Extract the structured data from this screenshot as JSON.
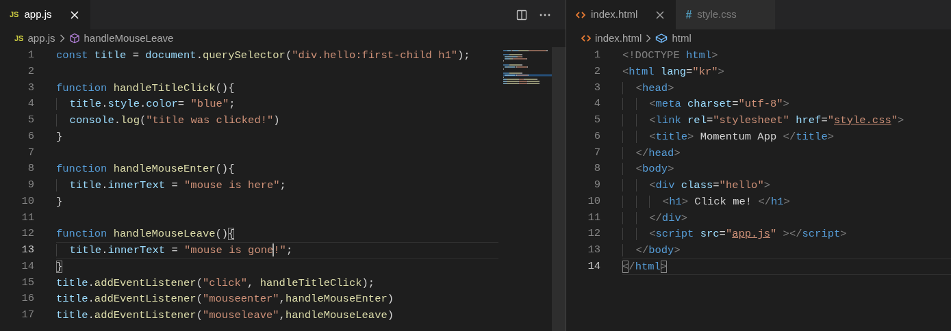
{
  "panes": [
    {
      "tabs": [
        {
          "kind": "js",
          "icon_text": "JS",
          "label": "app.js",
          "selected": true,
          "close_visible": true
        }
      ],
      "actions": [
        {
          "kind": "split"
        },
        {
          "kind": "more"
        }
      ],
      "breadcrumb": [
        {
          "kind": "js",
          "icon_text": "JS",
          "label": "app.js"
        },
        {
          "kind": "method",
          "label": "handleMouseLeave"
        }
      ],
      "minimap": true,
      "lines": [
        {
          "number": "1",
          "current": false,
          "tokens": [
            {
              "kind": "keyword",
              "text": "const "
            },
            {
              "kind": "variable",
              "text": "title"
            },
            {
              "kind": "plain",
              "text": " = "
            },
            {
              "kind": "variable",
              "text": "document"
            },
            {
              "kind": "plain",
              "text": "."
            },
            {
              "kind": "function",
              "text": "querySelector"
            },
            {
              "kind": "plain",
              "text": "("
            },
            {
              "kind": "string",
              "text": "\"div.hello:first-child h1\""
            },
            {
              "kind": "plain",
              "text": ");"
            }
          ]
        },
        {
          "number": "2",
          "current": false
        },
        {
          "number": "3",
          "current": false,
          "tokens": [
            {
              "kind": "keyword",
              "text": "function "
            },
            {
              "kind": "function",
              "text": "handleTitleClick"
            },
            {
              "kind": "plain",
              "text": "(){"
            }
          ]
        },
        {
          "number": "4",
          "current": false,
          "tokens": [
            {
              "kind": "variable",
              "text": "  title"
            },
            {
              "kind": "plain",
              "text": "."
            },
            {
              "kind": "variable",
              "text": "style"
            },
            {
              "kind": "plain",
              "text": "."
            },
            {
              "kind": "variable",
              "text": "color"
            },
            {
              "kind": "plain",
              "text": "= "
            },
            {
              "kind": "string",
              "text": "\"blue\""
            },
            {
              "kind": "plain",
              "text": ";"
            }
          ]
        },
        {
          "number": "5",
          "current": false,
          "tokens": [
            {
              "kind": "variable",
              "text": "  console"
            },
            {
              "kind": "plain",
              "text": "."
            },
            {
              "kind": "function",
              "text": "log"
            },
            {
              "kind": "plain",
              "text": "("
            },
            {
              "kind": "string",
              "text": "\"title was clicked!\""
            },
            {
              "kind": "plain",
              "text": ")"
            }
          ]
        },
        {
          "number": "6",
          "current": false,
          "tokens": [
            {
              "kind": "plain",
              "text": "}"
            }
          ]
        },
        {
          "number": "7",
          "current": false
        },
        {
          "number": "8",
          "current": false,
          "tokens": [
            {
              "kind": "keyword",
              "text": "function "
            },
            {
              "kind": "function",
              "text": "handleMouseEnter"
            },
            {
              "kind": "plain",
              "text": "(){"
            }
          ]
        },
        {
          "number": "9",
          "current": false,
          "tokens": [
            {
              "kind": "variable",
              "text": "  title"
            },
            {
              "kind": "plain",
              "text": "."
            },
            {
              "kind": "variable",
              "text": "innerText"
            },
            {
              "kind": "plain",
              "text": " = "
            },
            {
              "kind": "string",
              "text": "\"mouse is here\""
            },
            {
              "kind": "plain",
              "text": ";"
            }
          ]
        },
        {
          "number": "10",
          "current": false,
          "tokens": [
            {
              "kind": "plain",
              "text": "}"
            }
          ]
        },
        {
          "number": "11",
          "current": false
        },
        {
          "number": "12",
          "current": false,
          "tokens": [
            {
              "kind": "keyword",
              "text": "function "
            },
            {
              "kind": "function",
              "text": "handleMouseLeave"
            },
            {
              "kind": "plain",
              "text": "()"
            },
            {
              "kind": "matched-bracket",
              "text": "{"
            }
          ]
        },
        {
          "number": "13",
          "current": true,
          "tokens": [
            {
              "kind": "variable",
              "text": "  title"
            },
            {
              "kind": "plain",
              "text": "."
            },
            {
              "kind": "variable",
              "text": "innerText"
            },
            {
              "kind": "plain",
              "text": " = "
            },
            {
              "kind": "string",
              "text": "\"mouse is gone",
              "cursor_after": true
            },
            {
              "kind": "string",
              "text": "!\""
            },
            {
              "kind": "plain",
              "text": ";"
            }
          ]
        },
        {
          "number": "14",
          "current": false,
          "tokens": [
            {
              "kind": "matched-bracket",
              "text": "}"
            }
          ]
        },
        {
          "number": "15",
          "current": false,
          "tokens": [
            {
              "kind": "variable",
              "text": "title"
            },
            {
              "kind": "plain",
              "text": "."
            },
            {
              "kind": "function",
              "text": "addEventListener"
            },
            {
              "kind": "plain",
              "text": "("
            },
            {
              "kind": "string",
              "text": "\"click\""
            },
            {
              "kind": "plain",
              "text": ", "
            },
            {
              "kind": "function",
              "text": "handleTitleClick"
            },
            {
              "kind": "plain",
              "text": ");"
            }
          ]
        },
        {
          "number": "16",
          "current": false,
          "tokens": [
            {
              "kind": "variable",
              "text": "title"
            },
            {
              "kind": "plain",
              "text": "."
            },
            {
              "kind": "function",
              "text": "addEventListener"
            },
            {
              "kind": "plain",
              "text": "("
            },
            {
              "kind": "string",
              "text": "\"mouseenter\""
            },
            {
              "kind": "plain",
              "text": ","
            },
            {
              "kind": "function",
              "text": "handleMouseEnter"
            },
            {
              "kind": "plain",
              "text": ")"
            }
          ]
        },
        {
          "number": "17",
          "current": false,
          "tokens": [
            {
              "kind": "variable",
              "text": "title"
            },
            {
              "kind": "plain",
              "text": "."
            },
            {
              "kind": "function",
              "text": "addEventListener"
            },
            {
              "kind": "plain",
              "text": "("
            },
            {
              "kind": "string",
              "text": "\"mouseleave\""
            },
            {
              "kind": "plain",
              "text": ","
            },
            {
              "kind": "function",
              "text": "handleMouseLeave"
            },
            {
              "kind": "plain",
              "text": ")"
            }
          ]
        }
      ]
    },
    {
      "tabs": [
        {
          "kind": "html",
          "label": "index.html",
          "selected": true,
          "close_visible": true
        },
        {
          "kind": "css",
          "icon_text": "#",
          "label": "style.css",
          "selected": false,
          "close_visible": false
        }
      ],
      "breadcrumb": [
        {
          "kind": "html",
          "label": "index.html"
        },
        {
          "kind": "element",
          "label": "html"
        }
      ],
      "minimap": false,
      "lines": [
        {
          "number": "1",
          "current": false,
          "tokens": [
            {
              "kind": "punctuation",
              "text": "<!DOCTYPE "
            },
            {
              "kind": "tag",
              "text": "html"
            },
            {
              "kind": "punctuation",
              "text": ">"
            }
          ]
        },
        {
          "number": "2",
          "current": false,
          "tokens": [
            {
              "kind": "punctuation",
              "text": "<"
            },
            {
              "kind": "tag",
              "text": "html "
            },
            {
              "kind": "attribute",
              "text": "lang"
            },
            {
              "kind": "plain",
              "text": "="
            },
            {
              "kind": "string",
              "text": "\"kr\""
            },
            {
              "kind": "punctuation",
              "text": ">"
            }
          ]
        },
        {
          "number": "3",
          "current": false,
          "tokens": [
            {
              "kind": "punctuation",
              "text": "  <"
            },
            {
              "kind": "tag",
              "text": "head"
            },
            {
              "kind": "punctuation",
              "text": ">"
            }
          ]
        },
        {
          "number": "4",
          "current": false,
          "tokens": [
            {
              "kind": "punctuation",
              "text": "    <"
            },
            {
              "kind": "tag",
              "text": "meta "
            },
            {
              "kind": "attribute",
              "text": "charset"
            },
            {
              "kind": "plain",
              "text": "="
            },
            {
              "kind": "string",
              "text": "\"utf-8\""
            },
            {
              "kind": "punctuation",
              "text": ">"
            }
          ]
        },
        {
          "number": "5",
          "current": false,
          "tokens": [
            {
              "kind": "punctuation",
              "text": "    <"
            },
            {
              "kind": "tag",
              "text": "link "
            },
            {
              "kind": "attribute",
              "text": "rel"
            },
            {
              "kind": "plain",
              "text": "="
            },
            {
              "kind": "string",
              "text": "\"stylesheet\" "
            },
            {
              "kind": "attribute",
              "text": "href"
            },
            {
              "kind": "plain",
              "text": "="
            },
            {
              "kind": "string",
              "text": "\""
            },
            {
              "kind": "link",
              "text": "style.css"
            },
            {
              "kind": "string",
              "text": "\""
            },
            {
              "kind": "punctuation",
              "text": ">"
            }
          ]
        },
        {
          "number": "6",
          "current": false,
          "tokens": [
            {
              "kind": "punctuation",
              "text": "    <"
            },
            {
              "kind": "tag",
              "text": "title"
            },
            {
              "kind": "punctuation",
              "text": ">"
            },
            {
              "kind": "plain",
              "text": " Momentum App "
            },
            {
              "kind": "punctuation",
              "text": "</"
            },
            {
              "kind": "tag",
              "text": "title"
            },
            {
              "kind": "punctuation",
              "text": ">"
            }
          ]
        },
        {
          "number": "7",
          "current": false,
          "tokens": [
            {
              "kind": "punctuation",
              "text": "  </"
            },
            {
              "kind": "tag",
              "text": "head"
            },
            {
              "kind": "punctuation",
              "text": ">"
            }
          ]
        },
        {
          "number": "8",
          "current": false,
          "tokens": [
            {
              "kind": "punctuation",
              "text": "  <"
            },
            {
              "kind": "tag",
              "text": "body"
            },
            {
              "kind": "punctuation",
              "text": ">"
            }
          ]
        },
        {
          "number": "9",
          "current": false,
          "tokens": [
            {
              "kind": "punctuation",
              "text": "    <"
            },
            {
              "kind": "tag",
              "text": "div "
            },
            {
              "kind": "attribute",
              "text": "class"
            },
            {
              "kind": "plain",
              "text": "="
            },
            {
              "kind": "string",
              "text": "\"hello\""
            },
            {
              "kind": "punctuation",
              "text": ">"
            }
          ]
        },
        {
          "number": "10",
          "current": false,
          "tokens": [
            {
              "kind": "punctuation",
              "text": "      <"
            },
            {
              "kind": "tag",
              "text": "h1"
            },
            {
              "kind": "punctuation",
              "text": ">"
            },
            {
              "kind": "plain",
              "text": " Click me! "
            },
            {
              "kind": "punctuation",
              "text": "</"
            },
            {
              "kind": "tag",
              "text": "h1"
            },
            {
              "kind": "punctuation",
              "text": ">"
            }
          ]
        },
        {
          "number": "11",
          "current": false,
          "tokens": [
            {
              "kind": "punctuation",
              "text": "    </"
            },
            {
              "kind": "tag",
              "text": "div"
            },
            {
              "kind": "punctuation",
              "text": ">"
            }
          ]
        },
        {
          "number": "12",
          "current": false,
          "tokens": [
            {
              "kind": "punctuation",
              "text": "    <"
            },
            {
              "kind": "tag",
              "text": "script "
            },
            {
              "kind": "attribute",
              "text": "src"
            },
            {
              "kind": "plain",
              "text": "="
            },
            {
              "kind": "string",
              "text": "\""
            },
            {
              "kind": "link",
              "text": "app.js"
            },
            {
              "kind": "string",
              "text": "\" "
            },
            {
              "kind": "punctuation",
              "text": "></"
            },
            {
              "kind": "tag",
              "text": "script"
            },
            {
              "kind": "punctuation",
              "text": ">"
            }
          ]
        },
        {
          "number": "13",
          "current": false,
          "tokens": [
            {
              "kind": "punctuation",
              "text": "  </"
            },
            {
              "kind": "tag",
              "text": "body"
            },
            {
              "kind": "punctuation",
              "text": ">"
            }
          ]
        },
        {
          "number": "14",
          "current": true,
          "tokens": [
            {
              "kind": "matched-angle",
              "text": "<"
            },
            {
              "kind": "punctuation",
              "text": "/"
            },
            {
              "kind": "tag",
              "text": "html"
            },
            {
              "kind": "matched-angle",
              "text": ">"
            }
          ]
        }
      ]
    }
  ]
}
